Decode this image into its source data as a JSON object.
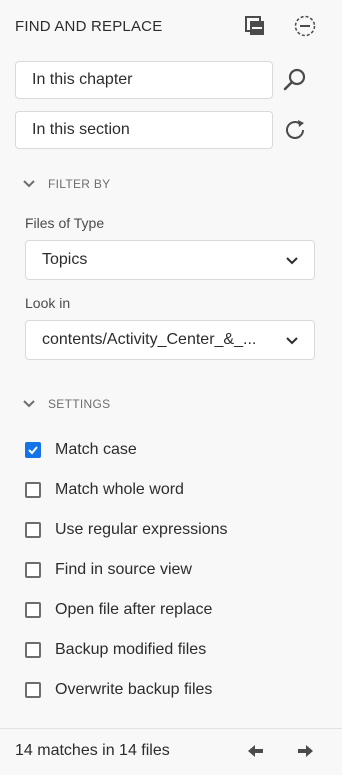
{
  "header": {
    "title": "FIND AND REPLACE"
  },
  "fields": {
    "find_value": "In this chapter",
    "replace_value": "In this section"
  },
  "filter": {
    "heading": "FILTER BY",
    "files_of_type_label": "Files of Type",
    "files_of_type_value": "Topics",
    "look_in_label": "Look in",
    "look_in_value": "contents/Activity_Center_&_..."
  },
  "settings": {
    "heading": "SETTINGS",
    "options": [
      {
        "label": "Match case",
        "checked": true
      },
      {
        "label": "Match whole word",
        "checked": false
      },
      {
        "label": "Use regular expressions",
        "checked": false
      },
      {
        "label": "Find in source view",
        "checked": false
      },
      {
        "label": "Open file after replace",
        "checked": false
      },
      {
        "label": "Backup modified files",
        "checked": false
      },
      {
        "label": "Overwrite backup files",
        "checked": false
      }
    ]
  },
  "footer": {
    "status": "14 matches in 14 files"
  },
  "colors": {
    "accent": "#1473e6",
    "text": "#2c2c2c",
    "muted": "#6e6e6e"
  },
  "icons": {
    "header": [
      "collapse-panel-icon",
      "minus-circle-icon"
    ],
    "find": "search-icon",
    "replace": "refresh-icon",
    "footer": [
      "arrow-left-icon",
      "arrow-right-icon"
    ]
  }
}
